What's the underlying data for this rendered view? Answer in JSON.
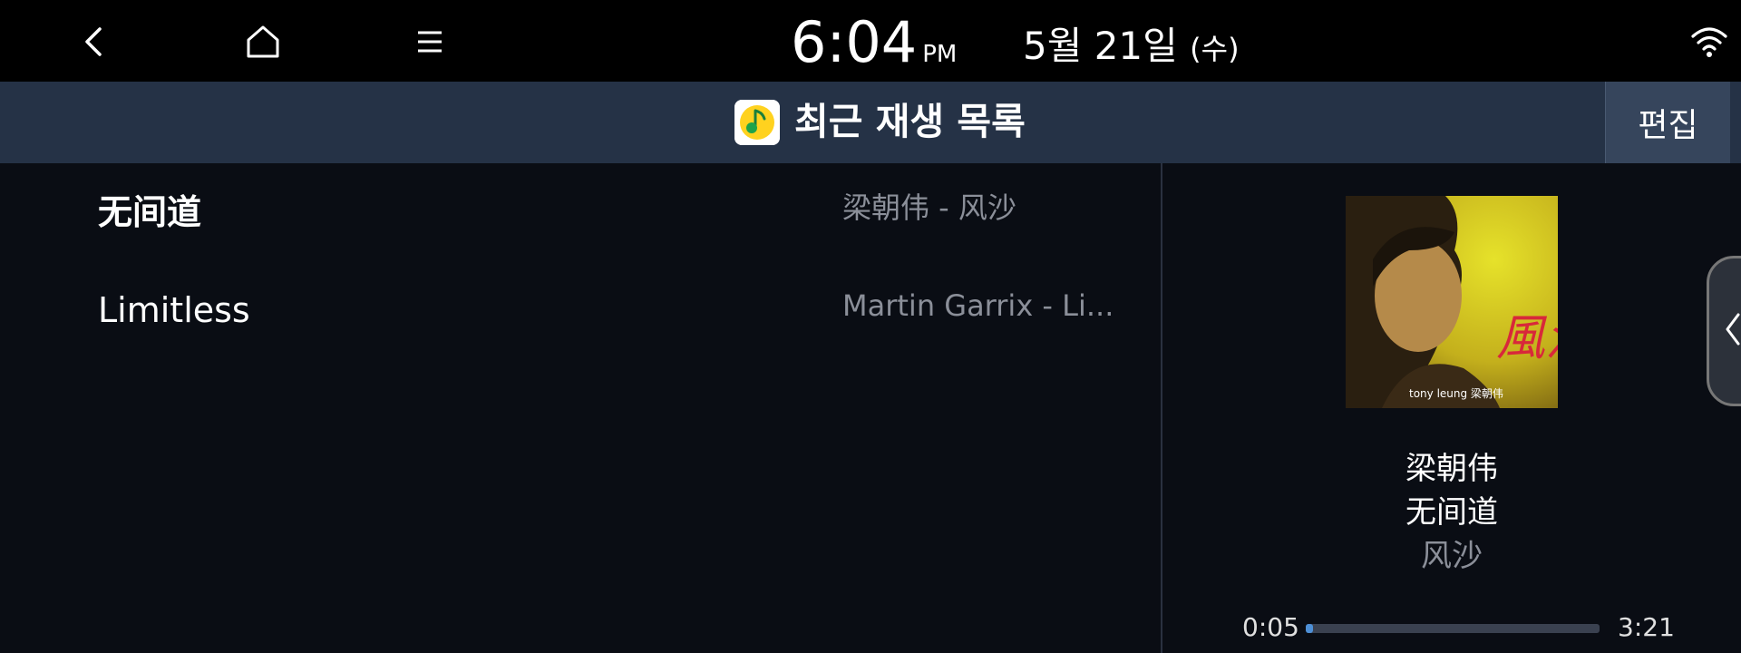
{
  "status_bar": {
    "back_icon": "chevron-left-icon",
    "home_icon": "home-icon",
    "menu_icon": "hamburger-menu-icon",
    "time": "6:04",
    "ampm": "PM",
    "date": "5월 21일",
    "weekday": "(수)",
    "wifi_icon": "wifi-icon"
  },
  "header": {
    "app_icon": "qq-music-icon",
    "title": "최근 재생 목록",
    "edit_label": "편집"
  },
  "tracks": [
    {
      "title": "无间道",
      "artist": "梁朝伟 - 风沙",
      "active": true
    },
    {
      "title": "Limitless",
      "artist": "Martin Garrix - Li...",
      "active": false
    }
  ],
  "now_playing": {
    "album_art_text": "風沙",
    "album_art_caption": "tony leung 梁朝伟",
    "artist": "梁朝伟",
    "title": "无间道",
    "album": "风沙",
    "elapsed": "0:05",
    "total": "3:21",
    "progress": 0.026
  },
  "colors": {
    "accent": "#4d8fd6",
    "titlebar": "#253246",
    "background": "#0a0d14"
  }
}
